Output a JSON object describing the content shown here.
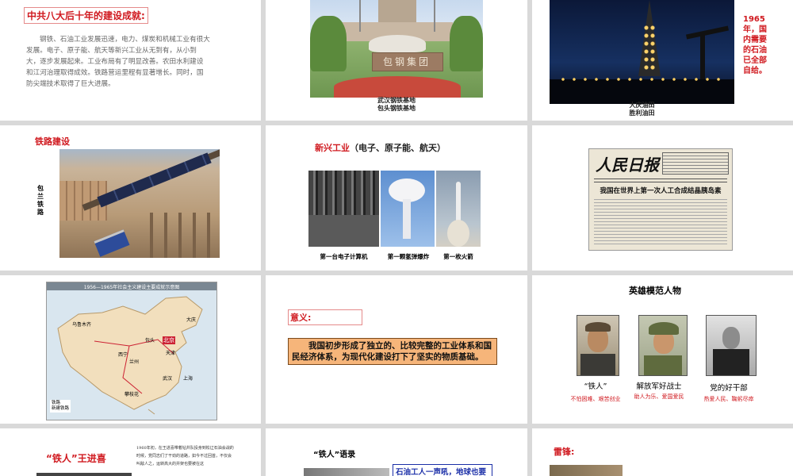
{
  "s1": {
    "title": "中共八大后十年的建设成就:",
    "body": "钢铁、石油工业发展迅速，电力、煤炭和机械工业有很大发展。电子、原子能、航天等新兴工业从无到有，从小到大，逐步发展起来。工业布局有了明显改善。农田水利建设和江河治理取得成效。铁路营运里程有显著增长。同时，国防尖端技术取得了巨大进展。"
  },
  "s2": {
    "sign": "包钢集团",
    "cap1": "武汉钢铁基地",
    "cap2": "包头钢铁基地"
  },
  "s3": {
    "note": "1965年，国内需要的石油已全部自给。",
    "cap1": "大庆油田",
    "cap2": "胜利油田"
  },
  "s4": {
    "title": "铁路建设",
    "side": "包兰铁路"
  },
  "s5": {
    "title": "新兴工业",
    "title_sub": "（电子、原子能、航天）",
    "caps": [
      "第一台电子计算机",
      "第一颗氢弹爆炸",
      "第一枚火箭"
    ]
  },
  "s6": {
    "masthead": "人民日报",
    "headline": "我国在世界上第一次人工合成结晶胰岛素"
  },
  "s7": {
    "map_title": "1956—1965年社会主义建设主要成就示意图",
    "places": [
      "北京",
      "乌鲁木齐",
      "兰州",
      "西宁",
      "包头",
      "天津",
      "上海",
      "武汉",
      "大庆",
      "攀枝花"
    ],
    "legend": [
      "铁路",
      "新建铁路"
    ]
  },
  "s8": {
    "label": "意义:",
    "text": "我国初步形成了独立的、比较完整的工业体系和国民经济体系，为现代化建设打下了坚实的物质基础。"
  },
  "s9": {
    "title": "英雄模范人物",
    "heroes": [
      {
        "name": "“铁人”",
        "desc": "不怕困难、艰苦创业"
      },
      {
        "name": "解放军好战士",
        "desc": "助人为乐、爱国爱民"
      },
      {
        "name": "党的好干部",
        "desc": "热爱人民、鞠躬尽瘁"
      }
    ]
  },
  "s10": {
    "title": "“铁人”王进喜",
    "body": "1960年初，在王进喜带着钻井队投身到松辽石油会战的时候，党同志们了干劲的道路，如今不过回首，不仅会叫敌人之，运转高大的井架也要被在这"
  },
  "s11": {
    "title": "“铁人”语录",
    "quote": "石油工人一声吼，地球也要"
  },
  "s12": {
    "title": "雷锋:"
  },
  "colors": {
    "accent_red": "#d0191f",
    "highlight_orange": "#f6b57a",
    "slide_gap": "#d9d9d9"
  }
}
